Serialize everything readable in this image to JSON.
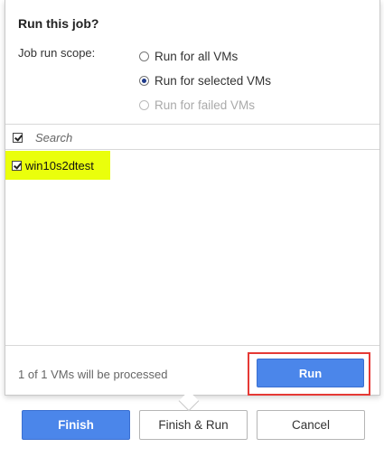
{
  "dialog": {
    "title": "Run this job?",
    "scope_label": "Job run scope:",
    "options": [
      {
        "label": "Run for all VMs",
        "checked": false,
        "disabled": false
      },
      {
        "label": "Run for selected VMs",
        "checked": true,
        "disabled": false
      },
      {
        "label": "Run for failed VMs",
        "checked": false,
        "disabled": true
      }
    ],
    "search_placeholder": "Search",
    "vms": [
      {
        "name": "win10s2dtest",
        "checked": true
      }
    ],
    "processed_text": "1 of 1 VMs will be processed",
    "run_label": "Run"
  },
  "buttons": {
    "finish": "Finish",
    "finish_run": "Finish & Run",
    "cancel": "Cancel"
  },
  "colors": {
    "accent": "#4b86ea",
    "highlight": "#eaff0c",
    "annotation": "#e53935"
  }
}
